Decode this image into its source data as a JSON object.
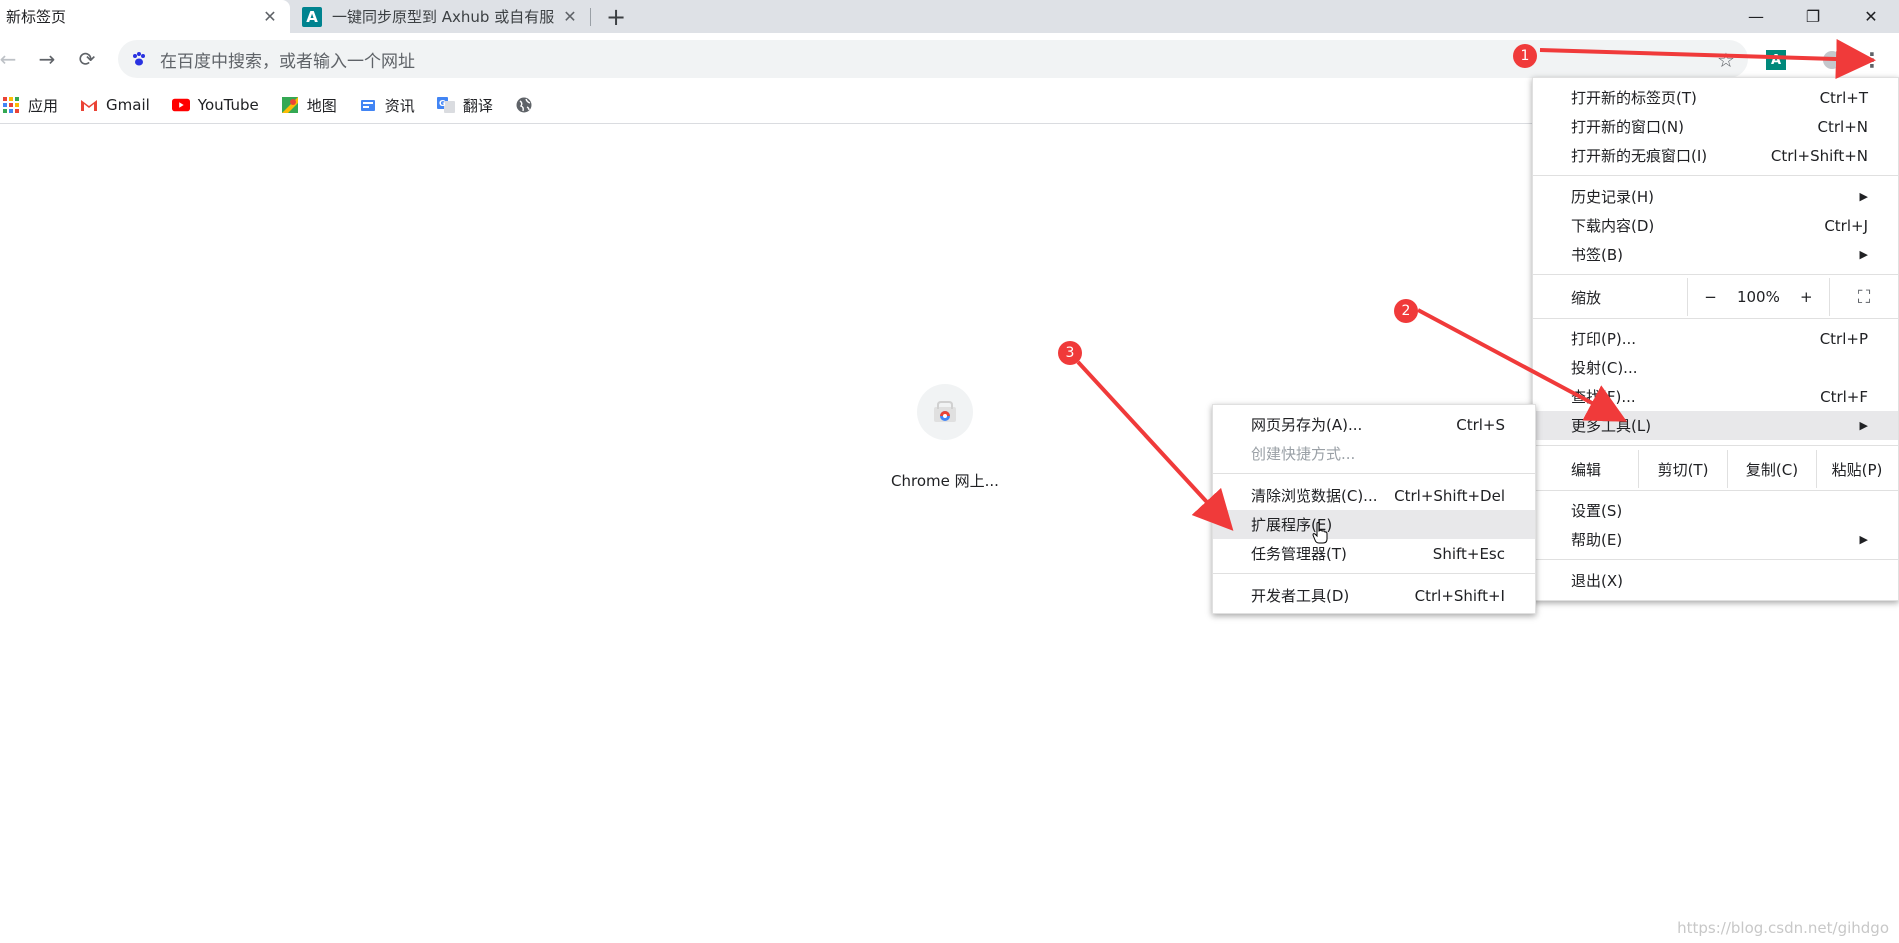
{
  "tabs": [
    {
      "title": "新标签页",
      "close": "✕"
    },
    {
      "icon_letter": "A",
      "title": "一键同步原型到 Axhub 或自有服",
      "close": "✕"
    }
  ],
  "new_tab": "+",
  "window_controls": {
    "minimize": "—",
    "restore": "❐",
    "close": "✕"
  },
  "toolbar": {
    "back": "←",
    "forward": "→",
    "reload": "⟳",
    "omnibox_placeholder": "在百度中搜索，或者输入一个网址",
    "star": "☆",
    "ext_badge_letter": "A",
    "menu": "⋮"
  },
  "bookmarks": [
    {
      "label": "应用",
      "icon": "apps-grid-icon"
    },
    {
      "label": "Gmail",
      "icon": "gmail-icon"
    },
    {
      "label": "YouTube",
      "icon": "youtube-icon"
    },
    {
      "label": "地图",
      "icon": "maps-icon"
    },
    {
      "label": "资讯",
      "icon": "news-icon"
    },
    {
      "label": "翻译",
      "icon": "translate-icon"
    }
  ],
  "shortcut": {
    "label": "Chrome 网上..."
  },
  "main_menu": {
    "new_tab": {
      "label": "打开新的标签页(T)",
      "shortcut": "Ctrl+T"
    },
    "new_window": {
      "label": "打开新的窗口(N)",
      "shortcut": "Ctrl+N"
    },
    "incognito": {
      "label": "打开新的无痕窗口(I)",
      "shortcut": "Ctrl+Shift+N"
    },
    "history": {
      "label": "历史记录(H)"
    },
    "downloads": {
      "label": "下载内容(D)",
      "shortcut": "Ctrl+J"
    },
    "bookmarks": {
      "label": "书签(B)"
    },
    "zoom": {
      "label": "缩放",
      "minus": "−",
      "value": "100%",
      "plus": "+",
      "fullscreen": "⛶"
    },
    "print": {
      "label": "打印(P)...",
      "shortcut": "Ctrl+P"
    },
    "cast": {
      "label": "投射(C)..."
    },
    "find": {
      "label": "查找(F)...",
      "shortcut": "Ctrl+F"
    },
    "more_tools": {
      "label": "更多工具(L)"
    },
    "edit": {
      "label": "编辑",
      "cut": "剪切(T)",
      "copy": "复制(C)",
      "paste": "粘贴(P)"
    },
    "settings": {
      "label": "设置(S)"
    },
    "help": {
      "label": "帮助(E)"
    },
    "exit": {
      "label": "退出(X)"
    }
  },
  "sub_menu": {
    "save_page": {
      "label": "网页另存为(A)...",
      "shortcut": "Ctrl+S"
    },
    "create_shortcut": {
      "label": "创建快捷方式..."
    },
    "clear_data": {
      "label": "清除浏览数据(C)...",
      "shortcut": "Ctrl+Shift+Del"
    },
    "extensions": {
      "label": "扩展程序(E)"
    },
    "task_manager": {
      "label": "任务管理器(T)",
      "shortcut": "Shift+Esc"
    },
    "dev_tools": {
      "label": "开发者工具(D)",
      "shortcut": "Ctrl+Shift+I"
    }
  },
  "annotations": {
    "step1": "1",
    "step2": "2",
    "step3": "3",
    "color": "#f03a3a"
  },
  "watermark": "https://blog.csdn.net/gihdgo"
}
